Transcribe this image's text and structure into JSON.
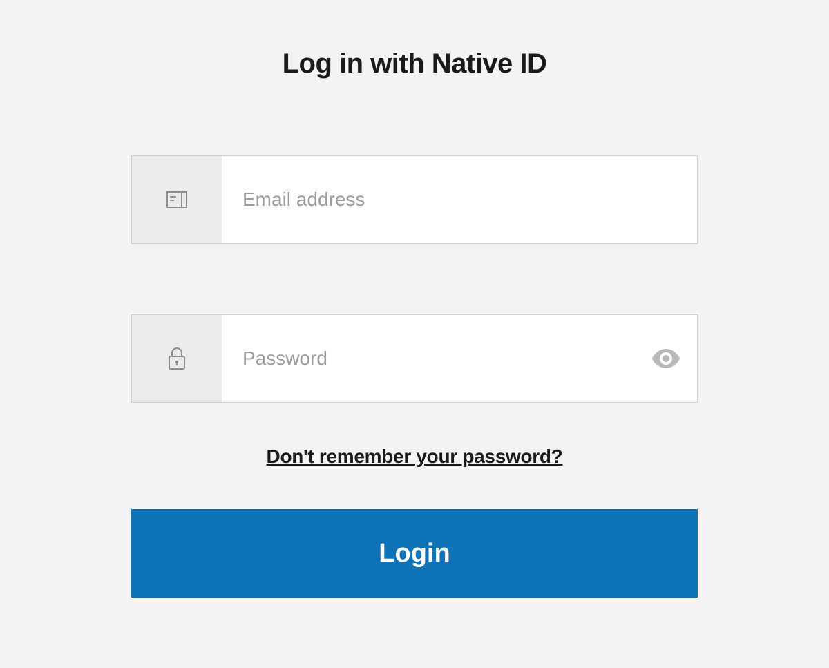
{
  "title": "Log in with Native ID",
  "emailField": {
    "placeholder": "Email address",
    "value": ""
  },
  "passwordField": {
    "placeholder": "Password",
    "value": ""
  },
  "forgotPasswordLabel": "Don't remember your password?",
  "loginButtonLabel": "Login",
  "colors": {
    "primary": "#0f73b8",
    "background": "#f3f3f3",
    "iconBox": "#ebebeb",
    "border": "#cfcfcf",
    "placeholder": "#9b9b9b",
    "text": "#1a1a1a",
    "iconStroke": "#8c8c8c"
  }
}
